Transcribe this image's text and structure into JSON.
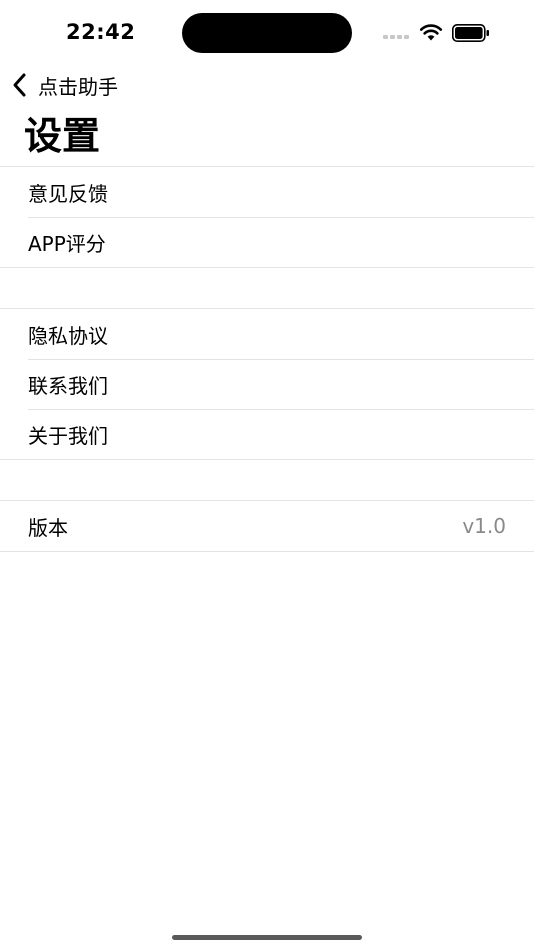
{
  "status_bar": {
    "time": "22:42"
  },
  "nav": {
    "back_label": "点击助手"
  },
  "page": {
    "title": "设置"
  },
  "groups": [
    {
      "rows": [
        {
          "label": "意见反馈"
        },
        {
          "label": "APP评分"
        }
      ]
    },
    {
      "rows": [
        {
          "label": "隐私协议"
        },
        {
          "label": "联系我们"
        },
        {
          "label": "关于我们"
        }
      ]
    },
    {
      "rows": [
        {
          "label": "版本",
          "value": "v1.0"
        }
      ]
    }
  ],
  "icons": {
    "back": "chevron-left-icon",
    "wifi": "wifi-icon",
    "battery": "battery-icon",
    "signal": "signal-icon"
  },
  "colors": {
    "background": "#ffffff",
    "separator": "#e3e3e3",
    "secondary_text": "#8a8a8a",
    "text": "#000000"
  }
}
